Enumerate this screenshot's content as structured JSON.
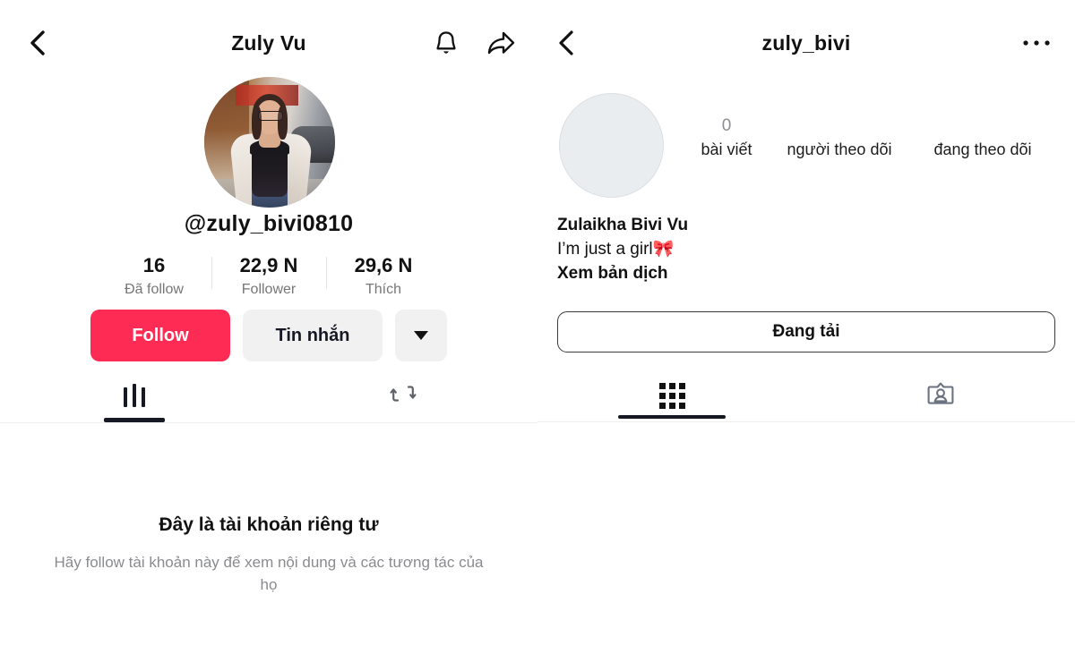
{
  "left_panel": {
    "app": "tiktok-profile",
    "header": {
      "back_icon": "chevron-left-icon",
      "title": "Zuly Vu",
      "notify_icon": "bell-icon",
      "share_icon": "share-arrow-icon"
    },
    "username": "@zuly_bivi0810",
    "stats": [
      {
        "value": "16",
        "label": "Đã follow"
      },
      {
        "value": "22,9 N",
        "label": "Follower"
      },
      {
        "value": "29,6 N",
        "label": "Thích"
      }
    ],
    "actions": {
      "follow_label": "Follow",
      "follow_color": "#fe2c55",
      "message_label": "Tin nhắn",
      "more_icon": "chevron-down-icon"
    },
    "tabs": [
      {
        "icon": "posts-bars-icon",
        "active": true
      },
      {
        "icon": "repost-icon",
        "active": false
      }
    ],
    "private_notice": {
      "title": "Đây là tài khoản riêng tư",
      "body": "Hãy follow tài khoản này để xem nội dung và các tương tác của họ"
    },
    "avatar": {
      "icon": "profile-photo",
      "alt": "woman with glasses in black top"
    }
  },
  "right_panel": {
    "app": "instagram-profile",
    "header": {
      "back_icon": "chevron-left-icon",
      "title": "zuly_bivi",
      "menu_icon": "more-horizontal-icon"
    },
    "avatar": {
      "icon": "avatar-placeholder",
      "color": "#e9edef"
    },
    "stats": [
      {
        "value": "0",
        "label": "bài viết"
      },
      {
        "value": "",
        "label": "người theo dõi"
      },
      {
        "value": "",
        "label": "đang theo dõi"
      }
    ],
    "bio": {
      "name": "Zulaikha Bivi Vu",
      "text": "I’m just a girl🎀",
      "translate_label": "Xem bản dịch"
    },
    "action": {
      "label": "Đang tải"
    },
    "tabs": [
      {
        "icon": "grid-icon",
        "active": true
      },
      {
        "icon": "tagged-person-icon",
        "active": false
      }
    ]
  }
}
